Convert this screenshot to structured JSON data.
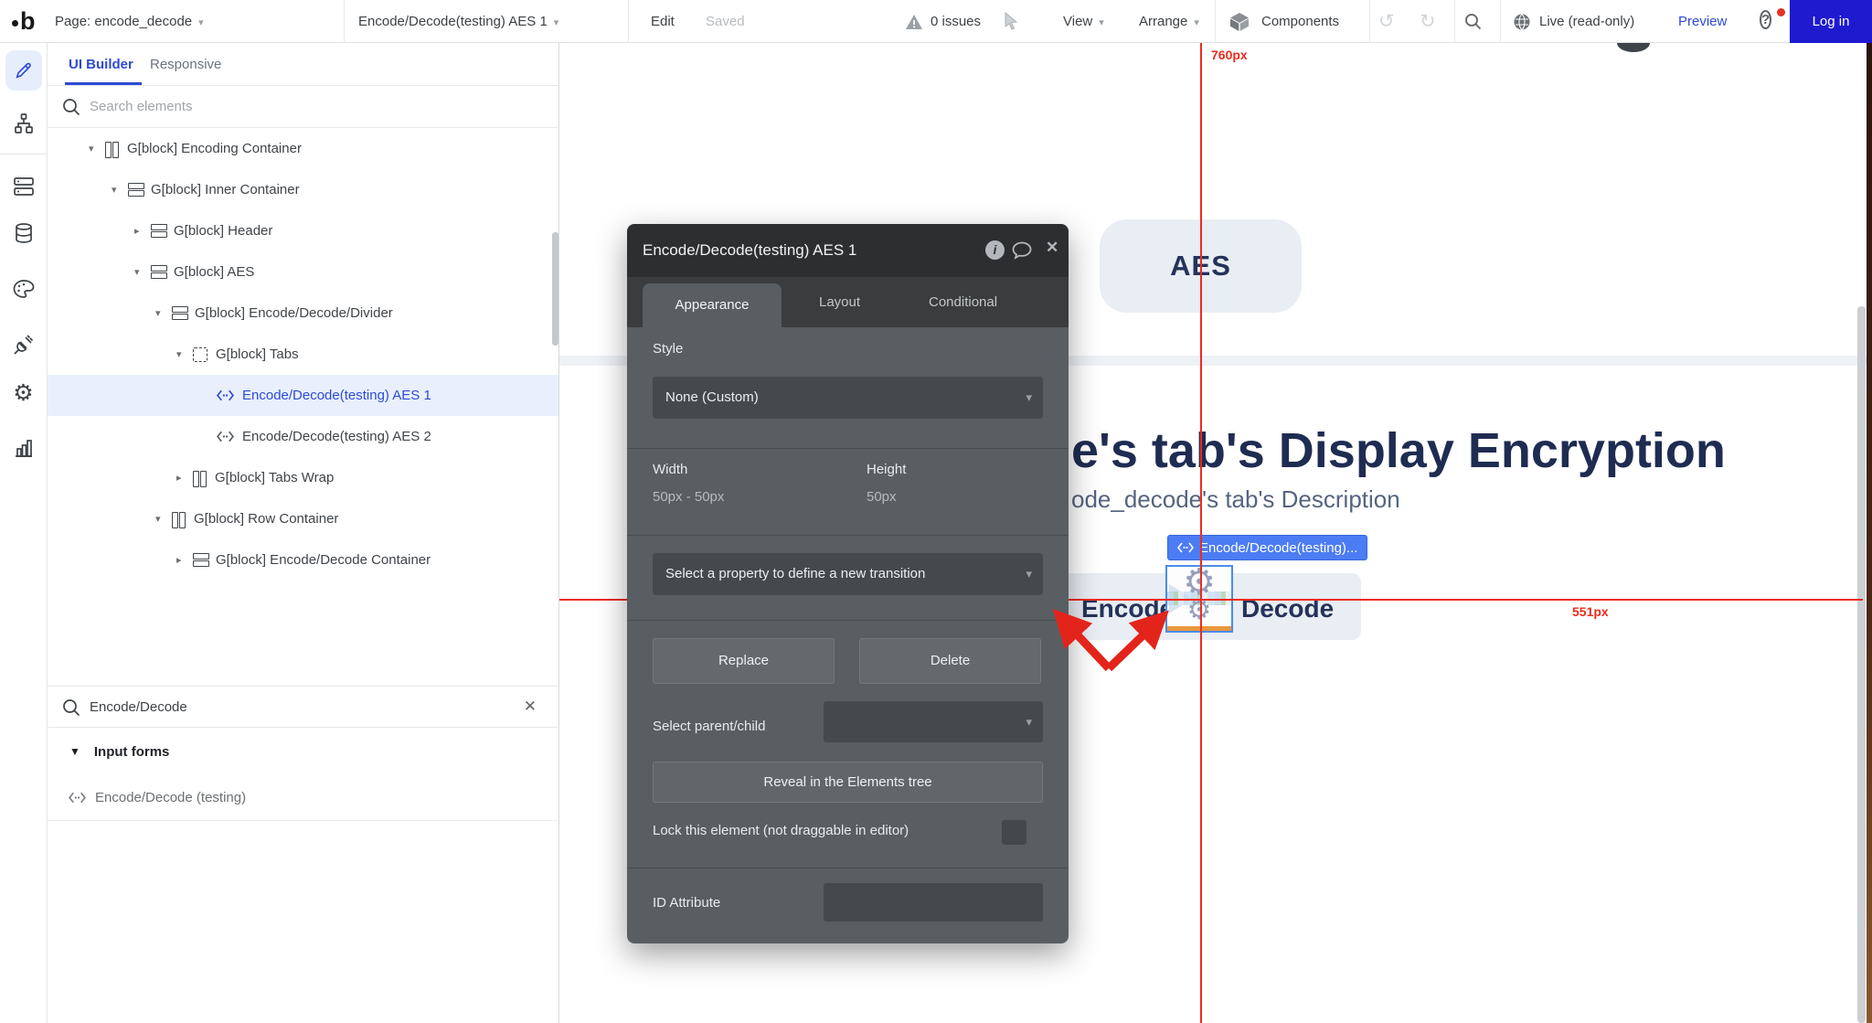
{
  "toolbar": {
    "logo": "b",
    "page_dropdown": "Page: encode_decode",
    "element_dropdown": "Encode/Decode(testing) AES 1",
    "edit": "Edit",
    "saved": "Saved",
    "issues": "0 issues",
    "view": "View",
    "arrange": "Arrange",
    "components": "Components",
    "live": "Live (read-only)",
    "preview": "Preview",
    "login": "Log in",
    "help": "?"
  },
  "left_panel": {
    "tabs": {
      "ui_builder": "UI Builder",
      "responsive": "Responsive"
    },
    "search_placeholder": "Search elements",
    "tree": {
      "items": [
        {
          "label": "G[block] Encoding Container"
        },
        {
          "label": "G[block] Inner Container"
        },
        {
          "label": "G[block] Header"
        },
        {
          "label": "G[block] AES"
        },
        {
          "label": "G[block] Encode/Decode/Divider"
        },
        {
          "label": "G[block] Tabs"
        },
        {
          "label": "Encode/Decode(testing) AES 1"
        },
        {
          "label": "Encode/Decode(testing) AES 2"
        },
        {
          "label": "G[block] Tabs Wrap"
        },
        {
          "label": "G[block] Row Container"
        },
        {
          "label": "G[block] Encode/Decode Container"
        }
      ]
    },
    "search2_value": "Encode/Decode",
    "results": {
      "group": "Input forms",
      "item": "Encode/Decode (testing)"
    }
  },
  "dialog": {
    "title": "Encode/Decode(testing) AES 1",
    "tabs": {
      "appearance": "Appearance",
      "layout": "Layout",
      "conditional": "Conditional"
    },
    "style_label": "Style",
    "style_value": "None (Custom)",
    "width_label": "Width",
    "width_value": "50px - 50px",
    "height_label": "Height",
    "height_value": "50px",
    "transition_placeholder": "Select a property to define a new transition",
    "replace": "Replace",
    "delete": "Delete",
    "parent_child_label": "Select parent/child",
    "reveal": "Reveal in the Elements tree",
    "lock_label": "Lock this element (not draggable in editor)",
    "id_label": "ID Attribute"
  },
  "canvas": {
    "aes": "AES",
    "heading": "e's tab's Display Encryption",
    "description": "ode_decode's tab's Description",
    "element_badge": "Encode/Decode(testing)...",
    "tab_encode": "Encode",
    "tab_decode": "Decode",
    "ruler_vertical": "760px",
    "ruler_horizontal": "551px"
  },
  "colors": {
    "accent_blue": "#2d4bd6",
    "login_blue": "#1d1ad0",
    "annotation_red": "#ed2b1d",
    "badge_blue": "#4c7cf3",
    "selection_blue": "#4a8ce8",
    "navy_text": "#24335a",
    "dialog_body": "#595e62"
  }
}
